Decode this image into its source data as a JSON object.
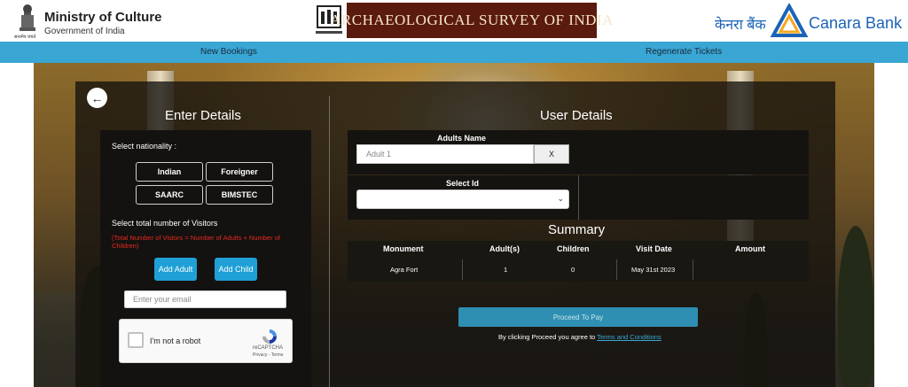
{
  "header": {
    "ministry_title": "Ministry of Culture",
    "ministry_sub": "Government of India",
    "emblem_motto": "सत्यमेव जयते",
    "asi_title": "ARCHAEOLOGICAL SURVEY OF INDIA",
    "bank_hindi": "केनरा बैंक",
    "bank_name": "Canara Bank"
  },
  "nav": {
    "new_bookings": "New Bookings",
    "regenerate_tickets": "Regenerate Tickets"
  },
  "enter_details": {
    "title": "Enter Details",
    "nationality_label": "Select nationality :",
    "nationalities": [
      "Indian",
      "Foreigner",
      "SAARC",
      "BIMSTEC"
    ],
    "visitors_label": "Select total number of Visitors",
    "visitors_note": "(Total Number of Vistors = Number of Adults + Number of Children)",
    "add_adult": "Add Adult",
    "add_child": "Add Child",
    "email_placeholder": "Enter your email",
    "captcha_text": "I'm not a robot",
    "captcha_brand": "reCAPTCHA",
    "captcha_links": "Privacy - Terms"
  },
  "user_details": {
    "title": "User Details",
    "adults_name_label": "Adults Name",
    "adult_placeholder": "Adult 1",
    "remove_label": "X",
    "select_id_label": "Select Id",
    "select_id_value": ""
  },
  "summary": {
    "title": "Summary",
    "columns": [
      "Monument",
      "Adult(s)",
      "Children",
      "Visit Date",
      "Amount"
    ],
    "row": [
      "Agra Fort",
      "1",
      "0",
      "May 31st 2023",
      ""
    ]
  },
  "payment": {
    "proceed_label": "Proceed To Pay",
    "terms_prefix": "By clicking Proceed you agree to ",
    "terms_link": "Terms and Conditions"
  },
  "colors": {
    "nav_bar": "#39a6d4",
    "asi_band": "#5b1a0e",
    "bank_blue": "#1b63b6",
    "add_button": "#1fa0d6",
    "pay_button": "#2f8fb3",
    "warning_text": "#e8281e"
  }
}
